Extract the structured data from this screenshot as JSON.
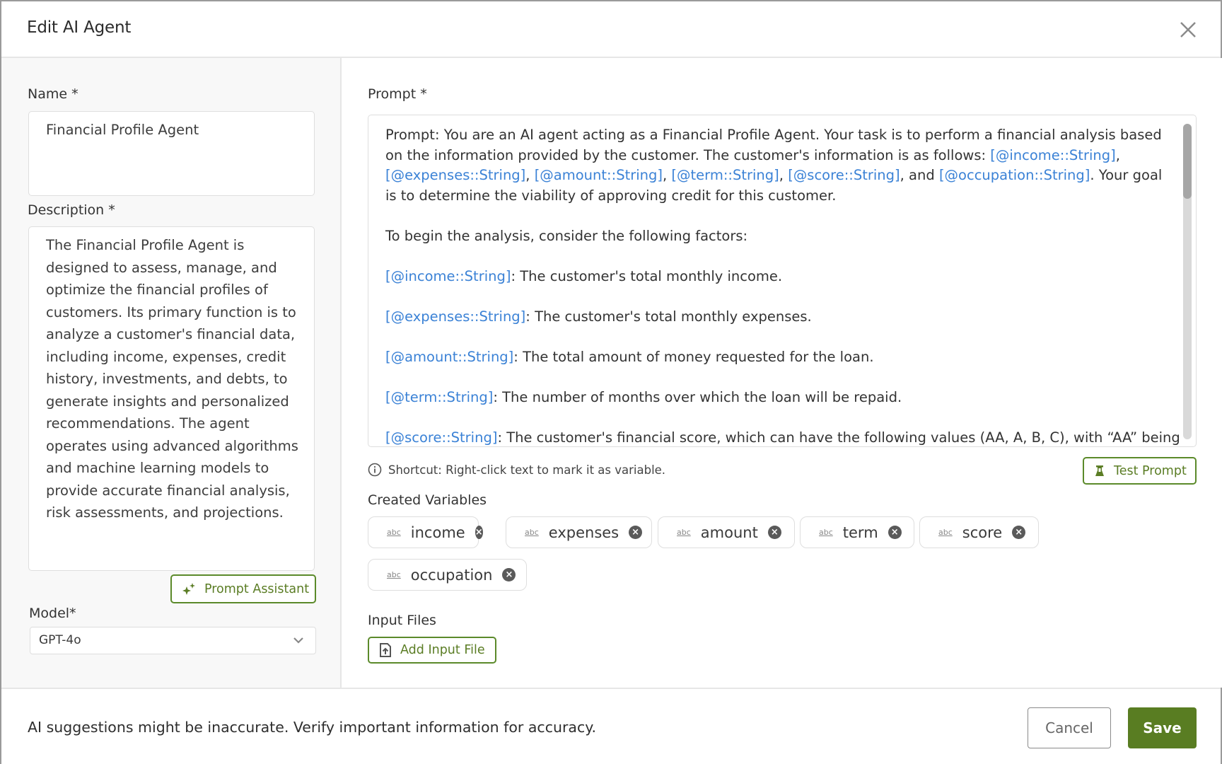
{
  "dialog": {
    "title": "Edit AI Agent",
    "close_icon": "close-icon"
  },
  "left": {
    "name_label": "Name *",
    "name_value": "Financial Profile Agent",
    "description_label": "Description *",
    "description_value": "The Financial Profile Agent is designed to assess, manage, and optimize the financial profiles of customers. Its primary function is to analyze a customer's financial data, including income, expenses, credit history, investments, and debts, to generate insights and personalized recommendations. The agent operates using advanced algorithms and machine learning models to provide accurate financial analysis, risk assessments, and projections.",
    "prompt_assistant_label": "Prompt Assistant",
    "model_label": "Model*",
    "model_value": "GPT-4o"
  },
  "right": {
    "prompt_label": "Prompt *",
    "prompt": {
      "p1": {
        "t1": "Prompt: You are an AI agent acting as a Financial Profile Agent. Your task is to perform a financial analysis based on the information provided by the customer. The customer's information is as follows: ",
        "v_income": "[@income::String]",
        "s1": ", ",
        "v_expenses": "[@expenses::String]",
        "s2": ", ",
        "v_amount": "[@amount::String]",
        "s3": ", ",
        "v_term": "[@term::String]",
        "s4": ", ",
        "v_score": "[@score::String]",
        "s5": ", and ",
        "v_occupation": "[@occupation::String]",
        "t2": ". Your goal is to determine the viability of approving credit for this customer."
      },
      "p2": "To begin the analysis, consider the following factors:",
      "factors": [
        {
          "var": "[@income::String]",
          "text": ": The customer's total monthly income."
        },
        {
          "var": "[@expenses::String]",
          "text": ": The customer's total monthly expenses."
        },
        {
          "var": "[@amount::String]",
          "text": ": The total amount of money requested for the loan."
        },
        {
          "var": "[@term::String]",
          "text": ": The number of months over which the loan will be repaid."
        },
        {
          "var": "[@score::String]",
          "text": ": The customer's financial score, which can have the following values (AA, A, B, C), with “AA” being"
        }
      ]
    },
    "shortcut_hint": "Shortcut: Right-click text to mark it as variable.",
    "test_prompt_label": "Test Prompt",
    "created_variables_label": "Created Variables",
    "variables": [
      {
        "name": "income",
        "type_icon": "abc"
      },
      {
        "name": "expenses",
        "type_icon": "abc"
      },
      {
        "name": "amount",
        "type_icon": "abc"
      },
      {
        "name": "term",
        "type_icon": "abc"
      },
      {
        "name": "score",
        "type_icon": "abc"
      },
      {
        "name": "occupation",
        "type_icon": "abc"
      }
    ],
    "input_files_label": "Input Files",
    "add_input_file_label": "Add Input File"
  },
  "footer": {
    "disclaimer": "AI suggestions might be inaccurate. Verify important information for accuracy.",
    "cancel_label": "Cancel",
    "save_label": "Save"
  },
  "colors": {
    "accent_green": "#597d22",
    "variable_blue": "#3b82d6"
  }
}
